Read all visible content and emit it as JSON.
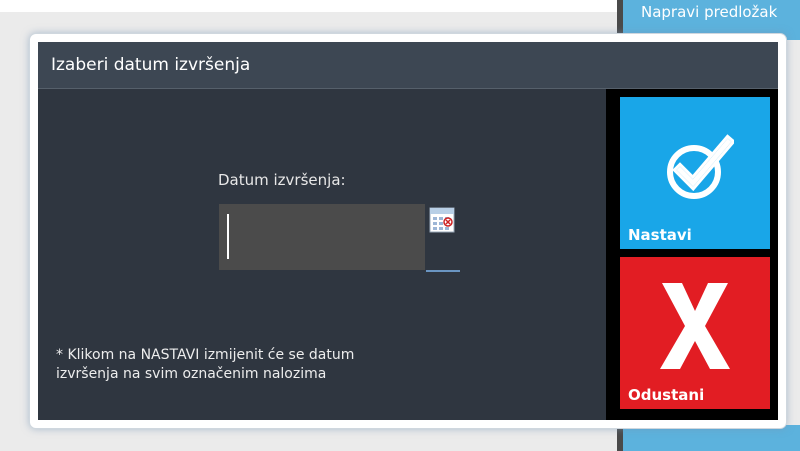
{
  "background": {
    "tile_text": "Napravi predložak"
  },
  "dialog": {
    "title": "Izaberi datum izvršenja",
    "date_label": "Datum izvršenja:",
    "date_value": "",
    "note_line1": "* Klikom na NASTAVI izmijenit će se datum",
    "note_line2": "izvršenja na svim označenim nalozima"
  },
  "actions": {
    "confirm_label": "Nastavi",
    "confirm_icon": "check-circle-icon",
    "cancel_label": "Odustani",
    "cancel_icon": "x-icon"
  },
  "colors": {
    "confirm": "#19a6e8",
    "cancel": "#e21d23",
    "dialog_bg": "#2f3640",
    "title_bg": "#3d4753"
  }
}
